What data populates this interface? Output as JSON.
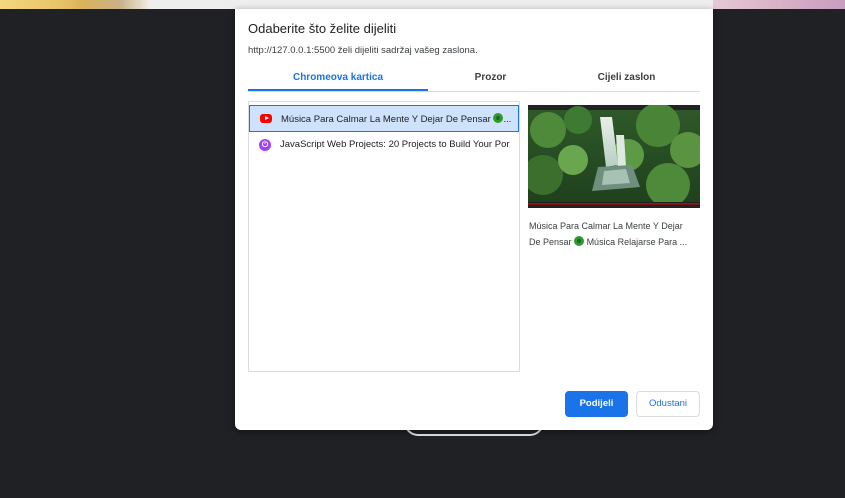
{
  "dialog": {
    "title": "Odaberite što želite dijeliti",
    "subtitle": "http://127.0.0.1:5500 želi dijeliti sadržaj vašeg zaslona.",
    "tabs": [
      {
        "label": "Chromeova kartica",
        "selected": true
      },
      {
        "label": "Prozor",
        "selected": false
      },
      {
        "label": "Cijeli zaslon",
        "selected": false
      }
    ],
    "items": [
      {
        "label": "Música Para Calmar La Mente Y Dejar De Pensar",
        "suffix": "...",
        "icon": "youtube-icon",
        "selected": true
      },
      {
        "label": "JavaScript Web Projects: 20 Projects to Build Your Por...",
        "icon": "javascript-course-icon",
        "selected": false
      }
    ],
    "preview": {
      "caption_line1": "Música Para Calmar La Mente Y Dejar",
      "caption_line2_a": "De Pensar",
      "caption_line2_b": "Música Relajarse Para ..."
    },
    "buttons": {
      "share": "Podijeli",
      "cancel": "Odustani"
    }
  },
  "colors": {
    "accent": "#1a73e8",
    "selected_bg": "#cfe2fc",
    "backdrop": "#202124"
  }
}
